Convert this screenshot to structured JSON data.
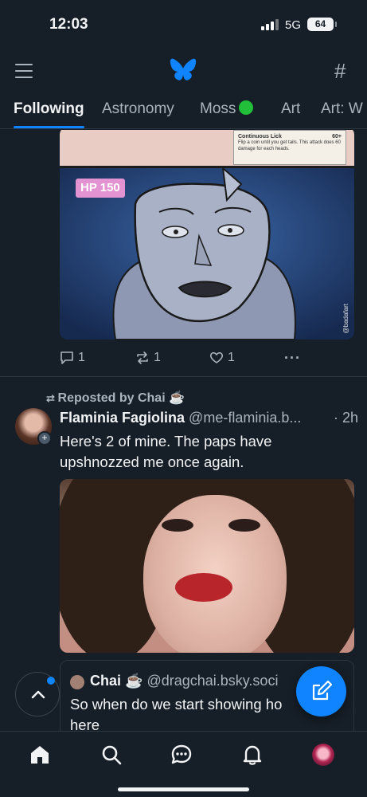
{
  "status_bar": {
    "time": "12:03",
    "network": "5G",
    "battery": "64"
  },
  "header": {
    "logo": "butterfly-icon",
    "menu_icon": "hamburger-icon",
    "feeds_icon": "hash-icon"
  },
  "tabs": [
    {
      "label": "Following",
      "active": true
    },
    {
      "label": "Astronomy",
      "active": false
    },
    {
      "label": "Moss",
      "active": false
    },
    {
      "label": "Art",
      "active": false
    },
    {
      "label": "Art: W",
      "active": false
    }
  ],
  "post1": {
    "card": {
      "title": "Continuous Lick",
      "damage": "60+",
      "text": "Flip a coin until you get tails. This attack does 60 damage for each heads."
    },
    "hp_badge": "HP 150",
    "watermark": "@badafart",
    "replies": "1",
    "reposts": "1",
    "likes": "1"
  },
  "post2": {
    "repost_label": "Reposted by Chai ☕",
    "author_name": "Flaminia Fagiolina",
    "author_handle": "@me-flaminia.b...",
    "time": "· 2h",
    "text": "Here's 2 of mine. The paps have upshnozzed me once again.",
    "quote": {
      "author_name": "Chai ☕",
      "author_handle": "@dragchai.bsky.soci",
      "text": "So when do we start showing ho here"
    }
  },
  "accent_color": "#1083fe",
  "background_color": "#161e27"
}
